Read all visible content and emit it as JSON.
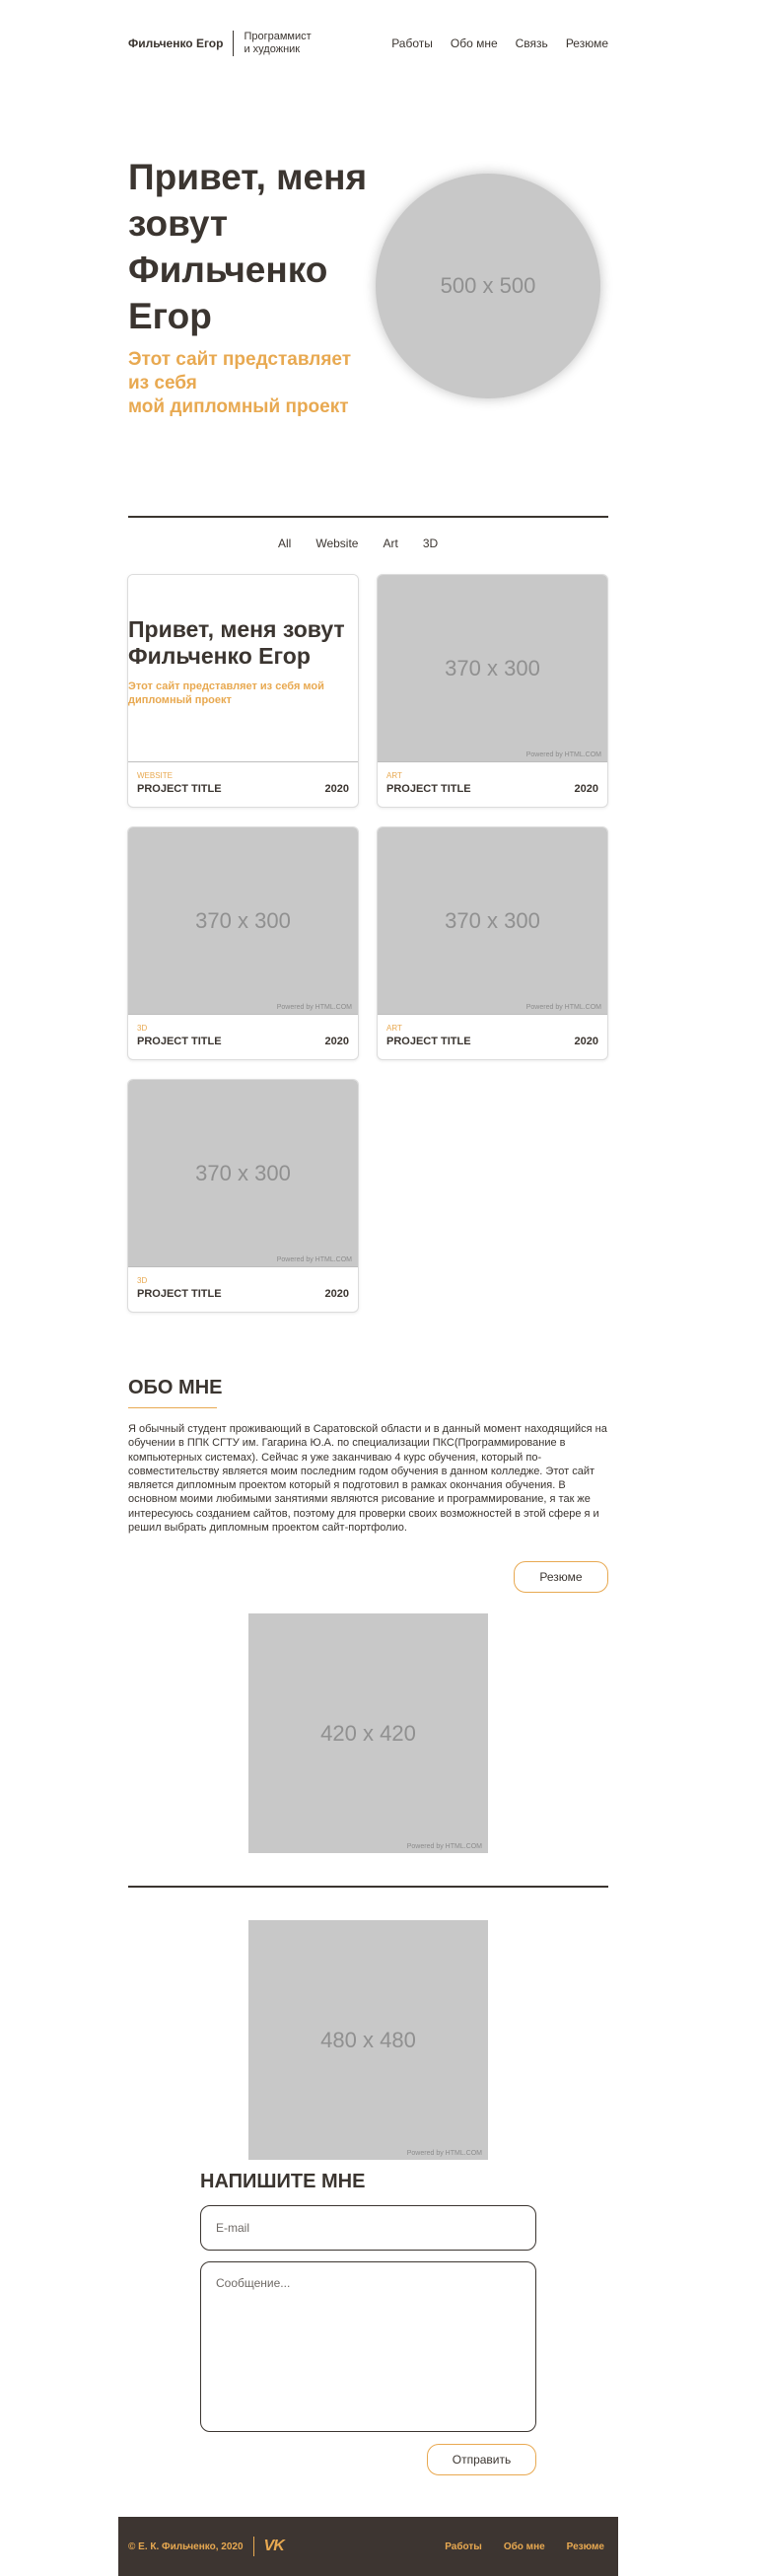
{
  "header": {
    "brand": "Фильченко Егор",
    "tagline_line1": "Программист",
    "tagline_line2": "и художник",
    "nav": [
      "Работы",
      "Обо мне",
      "Связь",
      "Резюме"
    ]
  },
  "hero": {
    "title": "Привет, меня зовут Фильченко Егор",
    "subtitle_line1": "Этот сайт представляет",
    "subtitle_line2": "из себя",
    "subtitle_line3": "мой дипломный проект",
    "photo_label": "500 x 500"
  },
  "filters": [
    "All",
    "Website",
    "Art",
    "3D"
  ],
  "projects": [
    {
      "category": "WEBSITE",
      "title": "PROJECT TITLE",
      "year": "2020",
      "preview_title": "Привет, меня зовут Фильченко Егор",
      "preview_sub": "Этот сайт представляет из себя мой дипломный проект"
    },
    {
      "category": "ART",
      "title": "PROJECT TITLE",
      "year": "2020",
      "image_label": "370 x 300",
      "powered": "Powered by HTML.COM"
    },
    {
      "category": "3D",
      "title": "PROJECT TITLE",
      "year": "2020",
      "image_label": "370 x 300",
      "powered": "Powered by HTML.COM"
    },
    {
      "category": "ART",
      "title": "PROJECT TITLE",
      "year": "2020",
      "image_label": "370 x 300",
      "powered": "Powered by HTML.COM"
    },
    {
      "category": "3D",
      "title": "PROJECT TITLE",
      "year": "2020",
      "image_label": "370 x 300",
      "powered": "Powered by HTML.COM"
    }
  ],
  "about": {
    "title": "ОБО МНЕ",
    "text": "Я обычный студент проживающий в Саратовской области и в данный момент находящийся на обучении в ППК СГТУ им. Гагарина Ю.А. по специализации ПКС(Программирование в компьютерных системах). Сейчас я уже заканчиваю 4 курс обучения, который по-совместительству является моим последним годом обучения в данном колледже. Этот сайт является дипломным проектом который я подготовил в рамках окончания обучения. В основном моими любимыми занятиями являются рисование и программирование, я так же интересуюсь созданием сайтов, поэтому для проверки своих возможностей в этой сфере я и решил выбрать дипломным проектом сайт-портфолио.",
    "resume_button": "Резюме",
    "photo_label": "420 x 420",
    "powered": "Powered by HTML.COM"
  },
  "contact": {
    "photo_label": "480 x 480",
    "powered": "Powered by HTML.COM",
    "title": "НАПИШИТЕ МНЕ",
    "email_placeholder": "E-mail",
    "message_placeholder": "Сообщение...",
    "submit_button": "Отправить"
  },
  "footer": {
    "copyright": "© Е. К. Фильченко, 2020",
    "vk_icon": "VK",
    "nav": [
      "Работы",
      "Обо мне",
      "Резюме"
    ]
  },
  "colors": {
    "accent": "#e8a951",
    "text": "#3b3530",
    "footer_bg": "#3d3531",
    "placeholder": "#c8c8c8"
  }
}
